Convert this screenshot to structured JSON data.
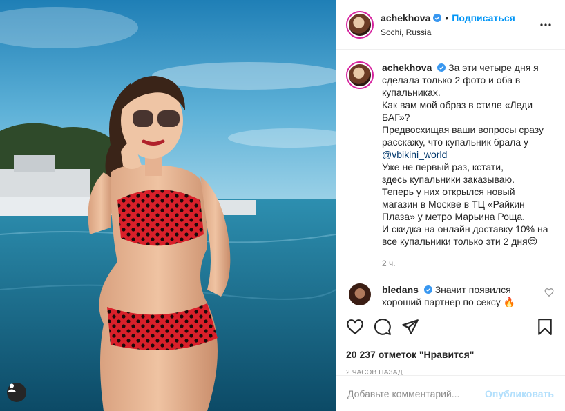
{
  "post": {
    "author": "achekhova",
    "location": "Sochi, Russia",
    "separator": "•",
    "follow_label": "Подписаться",
    "more_icon": "more-horizontal-icon",
    "verified_color": "#0095f6"
  },
  "caption": {
    "username": "achekhova",
    "lines_before": [
      "За эти четыре дня я",
      "сделала только 2 фото и оба в",
      "купальниках.",
      "Как вам мой образ в стиле «Леди",
      "БАГ»?",
      "Предвосхищая ваши вопросы сразу",
      "расскажу, что купальник брала у"
    ],
    "mention": "@vbikini_world",
    "lines_after": [
      "Уже не первый раз, кстати,",
      "здесь купальники заказываю.",
      "Теперь у них открылся новый",
      "магазин в Москве в ТЦ «Райкин",
      "Плаза» у метро Марьина Роща.",
      "И скидка на онлайн доставку 10% на",
      "все купальники только эти 2 дня😌"
    ],
    "time": "2 ч."
  },
  "comment": {
    "username": "bledans",
    "text": "Значит появился",
    "text_line2": "хороший партнер по сексу 🔥"
  },
  "actions": {
    "likes": "20 237 отметок \"Нравится\"",
    "posted": "2 ЧАСОВ НАЗАД",
    "icons": [
      "heart-icon",
      "comment-icon",
      "share-icon",
      "bookmark-icon"
    ]
  },
  "add_comment": {
    "placeholder": "Добавьте комментарий...",
    "publish_label": "Опубликовать"
  },
  "colors": {
    "link": "#0095f6",
    "publish_disabled": "#b2dffc",
    "swimsuit": "#d9202a"
  }
}
